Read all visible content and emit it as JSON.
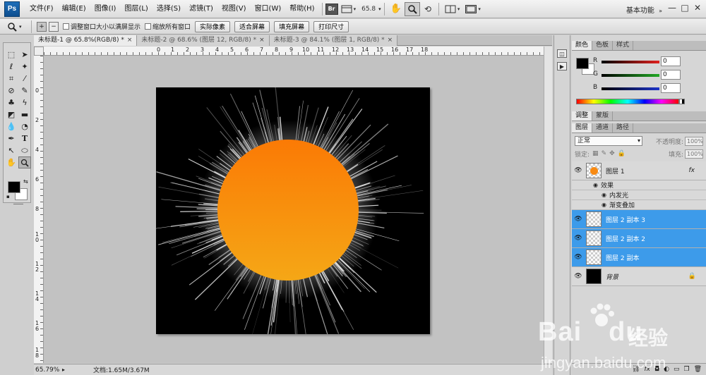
{
  "app": {
    "logo": "Ps",
    "workspace": "基本功能"
  },
  "menu": [
    "文件(F)",
    "编辑(E)",
    "图像(I)",
    "图层(L)",
    "选择(S)",
    "滤镜(T)",
    "视图(V)",
    "窗口(W)",
    "帮助(H)"
  ],
  "menubar": {
    "zoom": "65.8",
    "br_label": "Br"
  },
  "window_controls": {
    "minimize": "—",
    "restore": "□",
    "close": "✕"
  },
  "options": {
    "tool_icon": "magnifier-icon",
    "zoom_in": "+",
    "zoom_out": "−",
    "check1": "调整窗口大小以满屏显示",
    "check2": "缩放所有窗口",
    "btn_actual": "实际像素",
    "btn_fit": "适合屏幕",
    "btn_fill": "填充屏幕",
    "btn_print": "打印尺寸"
  },
  "tabs": [
    {
      "label": "未标题-1 @ 65.8%(RGB/8) *"
    },
    {
      "label": "未标题-2 @ 68.6% (图层 12, RGB/8) *"
    },
    {
      "label": "未标题-3 @ 84.1% (图层 1, RGB/8) *"
    }
  ],
  "tab_close": "×",
  "ruler_top": [
    "0",
    "1",
    "2",
    "3",
    "4",
    "5",
    "6",
    "7",
    "8",
    "9",
    "10",
    "11",
    "12",
    "13",
    "14",
    "15",
    "16",
    "17",
    "18"
  ],
  "ruler_left": [
    "0",
    "2",
    "4",
    "6",
    "8",
    "1 0",
    "1 2",
    "1 4",
    "1 6",
    "1 8"
  ],
  "status": {
    "zoom": "65.79%",
    "doc": "文档:1.65M/3.67M"
  },
  "color_panel": {
    "tabs": [
      "颜色",
      "色板",
      "样式"
    ],
    "channels": [
      {
        "label": "R",
        "value": "0",
        "color": "#e0201d"
      },
      {
        "label": "G",
        "value": "0",
        "color": "#21a824"
      },
      {
        "label": "B",
        "value": "0",
        "color": "#1c33c9"
      }
    ]
  },
  "adjust_panel": {
    "tabs": [
      "调整",
      "蒙版"
    ]
  },
  "layers_panel": {
    "tabs": [
      "图层",
      "通道",
      "路径"
    ],
    "blend_mode": "正常",
    "opacity_label": "不透明度:",
    "opacity_value": "100%",
    "lock_label": "锁定:",
    "fill_label": "填充:",
    "fill_value": "100%",
    "layers": [
      {
        "name": "图层 1",
        "fx": "fx",
        "selected": false,
        "thumb": "sun"
      },
      {
        "name": "图层 2 副本 3",
        "selected": true,
        "thumb": "transparent"
      },
      {
        "name": "图层 2 副本 2",
        "selected": true,
        "thumb": "transparent"
      },
      {
        "name": "图层 2 副本",
        "selected": true,
        "thumb": "transparent"
      },
      {
        "name": "背景",
        "selected": false,
        "thumb": "black",
        "lock": "🔒"
      }
    ],
    "effects_label": "效果",
    "effects": [
      "内发光",
      "渐变叠加"
    ],
    "bottom_icons": [
      "link-icon",
      "fx-icon",
      "mask-icon",
      "adjustment-icon",
      "group-icon",
      "new-layer-icon",
      "trash-icon"
    ],
    "bottom_labels": [
      "⛓",
      "fx",
      "◘",
      "◐",
      "▭",
      "❐",
      "🗑"
    ]
  },
  "watermark": {
    "brand": "Bai",
    "brand2": "du",
    "cn": "经验",
    "url": "jingyan.baidu.com"
  },
  "colors": {
    "sun_top": "#fb7a05",
    "sun_bottom": "#f5a716",
    "selection": "#3d9bea"
  }
}
